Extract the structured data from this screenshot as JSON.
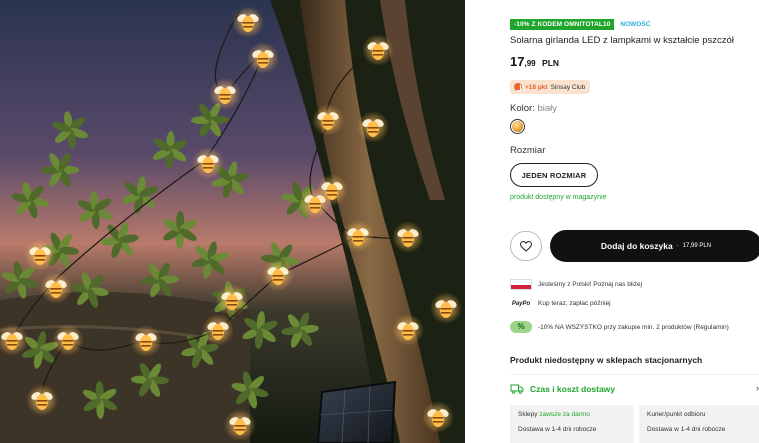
{
  "product": {
    "promo_badge": "-10% Z KODEM OMNITOTAL10",
    "new_badge": "NOWOŚĆ",
    "title": "Solarna girlanda LED z lampkami w kształcie pszczół",
    "price_int": "17",
    "price_dec": ",99",
    "price_currency": "PLN",
    "points_text": "+18 pkt",
    "points_club": "Sinsay Club",
    "color_label": "Kolor:",
    "color_value": "biały",
    "size_label": "Rozmiar",
    "size_option": "JEDEN ROZMIAR",
    "stock_status": "produkt dostępny w magazynie"
  },
  "actions": {
    "wishlist_icon": "heart-icon",
    "add_to_cart_label": "Dodaj do koszyka",
    "add_to_cart_separator": "·",
    "add_to_cart_price": "17,99 PLN"
  },
  "features": [
    {
      "icon": "poland-flag-icon",
      "text": "Jesteśmy z Polski! Poznaj nas bliżej"
    },
    {
      "icon": "paypo-logo",
      "icon_text": "PayPo",
      "text": "Kup teraz, zapłać później"
    },
    {
      "icon": "discount-icon",
      "text": "-10% NA WSZYSTKO przy zakupie min. 2 produktów (Regulamin)"
    }
  ],
  "stores": {
    "unavailable": "Produkt niedostępny w sklepach stacjonarnych"
  },
  "delivery": {
    "title": "Czas i koszt dostawy",
    "chevron_icon": "chevron-right-icon",
    "cards": [
      {
        "title": "Sklepy",
        "title_extra": "zawsze za darmo",
        "sub": "Dostawa w 1-4 dni robocze"
      },
      {
        "title": "Kurier/punkt odbioru",
        "title_extra": "",
        "sub": "Dostawa w 1-4 dni robocze"
      }
    ]
  },
  "colors": {
    "promo_green": "#1fa52b",
    "new_blue": "#2bb0d8",
    "points_orange": "#e8662e",
    "cart_black": "#111111"
  }
}
